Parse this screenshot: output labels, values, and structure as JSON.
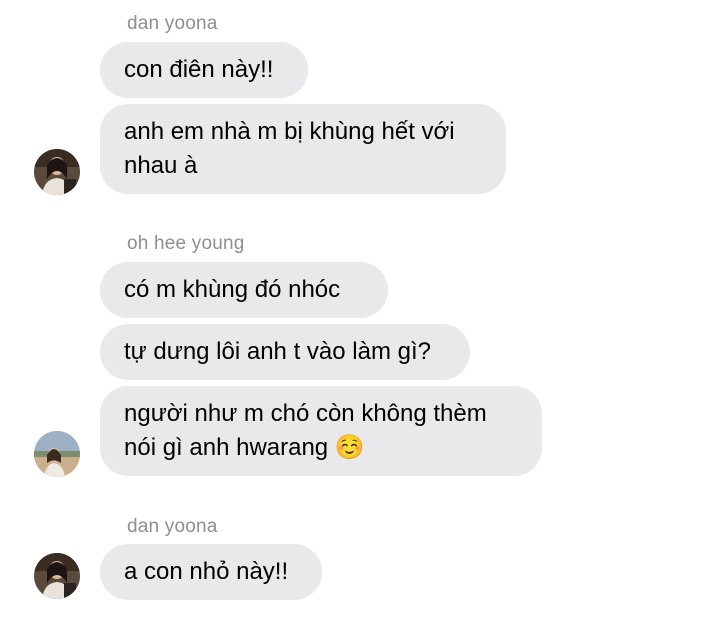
{
  "conversation": {
    "groups": [
      {
        "sender": "dan yoona",
        "avatar_icon": "user-avatar-dan-yoona",
        "messages": [
          "con điên này!!",
          "anh em nhà m bị khùng hết với\nnhau à"
        ]
      },
      {
        "sender": "oh hee young",
        "avatar_icon": "user-avatar-oh-hee-young",
        "messages": [
          "có m khùng đó nhóc",
          "tự dưng lôi anh t vào làm gì?",
          "người như m chó còn không thèm\nnói gì anh hwarang"
        ],
        "emoji": "☺️"
      },
      {
        "sender": "dan yoona",
        "avatar_icon": "user-avatar-dan-yoona",
        "messages": [
          "a con nhỏ này!!"
        ]
      }
    ]
  },
  "colors": {
    "bubble_bg": "#e9e9eb",
    "sender_text": "#8e8e93",
    "message_text": "#000000"
  }
}
